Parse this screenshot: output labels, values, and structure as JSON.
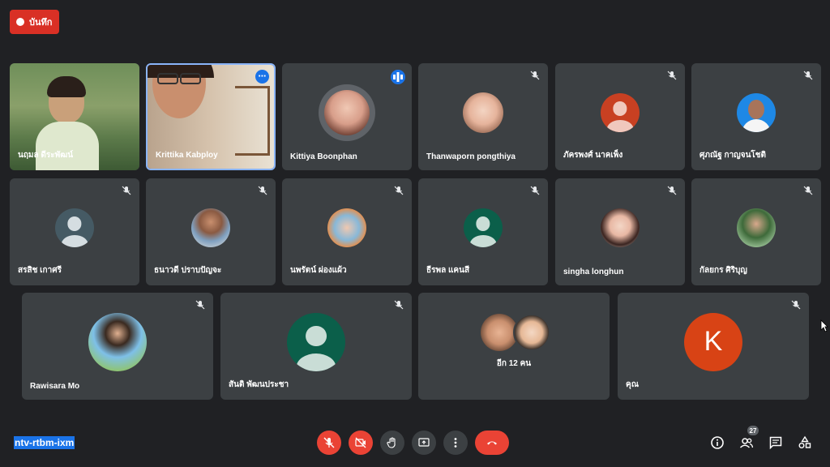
{
  "recording": {
    "label": "บันทึก",
    "color": "#d93025"
  },
  "tiles_row1": [
    {
      "name": "นฤมล ดีระพัฒน์",
      "type": "video",
      "muted": false
    },
    {
      "name": "Krittika Kabploy",
      "type": "video",
      "muted": false,
      "speaking_border": true,
      "more_icon": "more-horiz-icon"
    },
    {
      "name": "Kittiya Boonphan",
      "type": "photo",
      "muted": false,
      "speaking_icon": "audio-wave-icon"
    },
    {
      "name": "Thanwaporn pongthiya",
      "type": "photo",
      "muted": true
    },
    {
      "name": "ภัครพงศ์ นาคเพ็ง",
      "type": "default",
      "muted": true,
      "color": "#c84022"
    },
    {
      "name": "ศุภณัฐ กาญจนโชติ",
      "type": "photo",
      "muted": true
    }
  ],
  "tiles_row2": [
    {
      "name": "สรสิช เกาศรี",
      "type": "default",
      "muted": true,
      "color": "#455a64"
    },
    {
      "name": "ธนาวดี ปราบปัญจะ",
      "type": "photo",
      "muted": true
    },
    {
      "name": "นพรัตน์ ผ่องแผ้ว",
      "type": "photo",
      "muted": true
    },
    {
      "name": "ธีรพล แคนสี",
      "type": "default",
      "muted": true,
      "color": "#0b5f4a"
    },
    {
      "name": "singha longhun",
      "type": "photo",
      "muted": true
    },
    {
      "name": "กัลยกร ศิริบุญ",
      "type": "photo",
      "muted": true
    }
  ],
  "tiles_row3": [
    {
      "name": "Rawisara Mo",
      "type": "photo",
      "muted": true
    },
    {
      "name": "สันติ พัฒนประชา",
      "type": "default",
      "muted": true,
      "color": "#0b5f4a"
    },
    {
      "name": "",
      "type": "others",
      "muted": false,
      "more_label": "อีก 12 คน"
    },
    {
      "name": "คุณ",
      "type": "letter",
      "letter": "K",
      "muted": true,
      "color": "#d84315"
    }
  ],
  "meeting_code": "ntv-rtbm-ixm",
  "toolbar": {
    "buttons": [
      {
        "icon": "mic-off-icon",
        "color": "#ea4335"
      },
      {
        "icon": "videocam-off-icon",
        "color": "#ea4335"
      },
      {
        "icon": "raise-hand-icon",
        "color": "#3c4043"
      },
      {
        "icon": "present-screen-icon",
        "color": "#3c4043"
      },
      {
        "icon": "more-vert-icon",
        "color": "#3c4043"
      },
      {
        "icon": "end-call-icon",
        "color": "#ea4335"
      }
    ]
  },
  "right_controls": {
    "icons": [
      "info-icon",
      "people-icon",
      "chat-icon",
      "activities-icon"
    ],
    "participant_count": "27"
  }
}
